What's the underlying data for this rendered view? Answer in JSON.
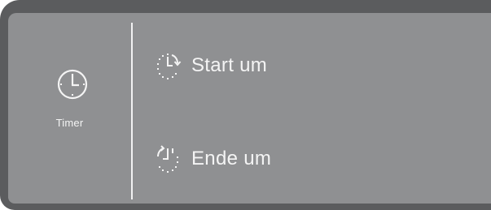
{
  "side_panel": {
    "icon": "clock-icon",
    "label": "Timer"
  },
  "menu": {
    "items": [
      {
        "icon": "clock-start-icon",
        "label": "Start um"
      },
      {
        "icon": "clock-end-icon",
        "label": "Ende um"
      }
    ]
  },
  "colors": {
    "frame": "#5b5c5e",
    "screen": "#8f9092",
    "text": "#f4f4f4"
  }
}
